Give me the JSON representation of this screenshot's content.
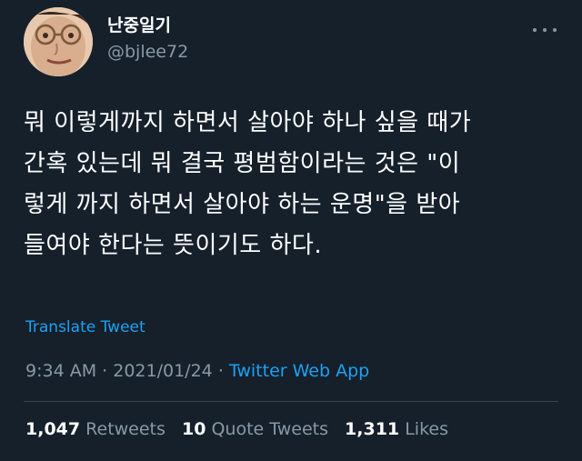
{
  "user": {
    "display_name": "난중일기",
    "handle": "@bjlee72"
  },
  "more_icon": "more-horizontal-icon",
  "tweet": {
    "text": "뭐 이렇게까지 하면서 살아야 하나 싶을 때가\n간혹 있는데 뭐 결국 평범함이라는 것은 \"이\n렇게 까지 하면서 살아야 하는 운명\"을 받아\n들여야 한다는 뜻이기도 하다.",
    "translate_label": "Translate Tweet",
    "time": "9:34 AM",
    "date": "2021/01/24",
    "separator": "·",
    "source": "Twitter Web App"
  },
  "stats": {
    "retweets_count": "1,047",
    "retweets_label": "Retweets",
    "quotes_count": "10",
    "quotes_label": "Quote Tweets",
    "likes_count": "1,311",
    "likes_label": "Likes"
  },
  "colors": {
    "background": "#15202b",
    "text": "#ffffff",
    "secondary": "#8899a6",
    "accent": "#1da1f2",
    "divider": "#38444d"
  }
}
